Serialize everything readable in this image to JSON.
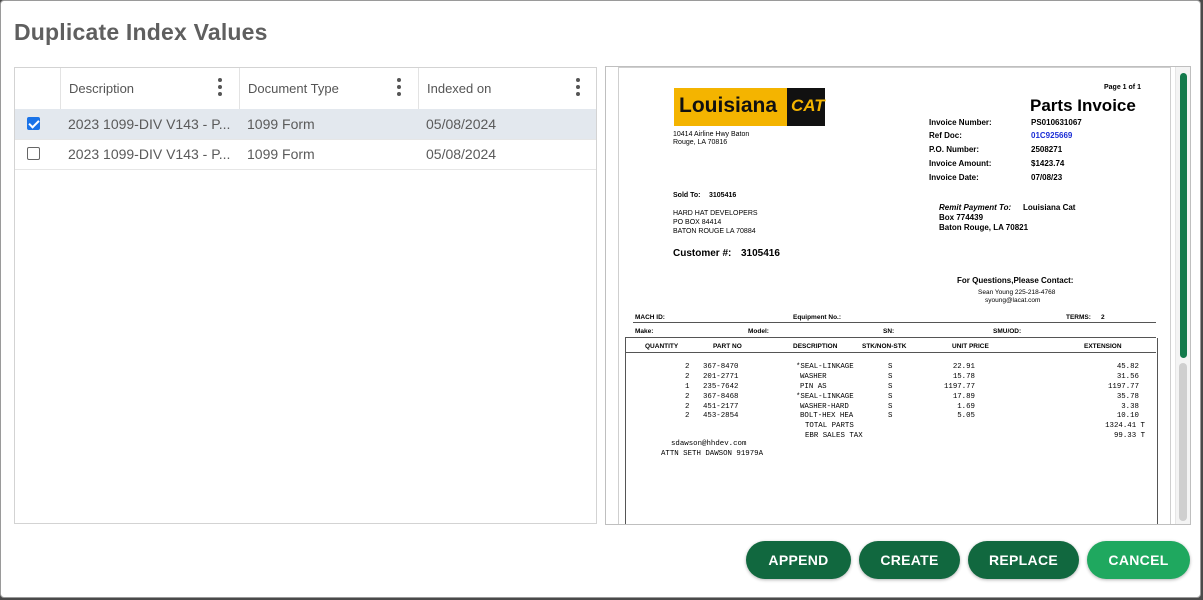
{
  "dialog": {
    "title": "Duplicate Index Values"
  },
  "grid": {
    "columns": [
      "Description",
      "Document Type",
      "Indexed on"
    ],
    "rows": [
      {
        "checked": true,
        "description": "2023 1099-DIV V143 - P...",
        "document_type": "1099 Form",
        "indexed_on": "05/08/2024"
      },
      {
        "checked": false,
        "description": "2023 1099-DIV V143 - P...",
        "document_type": "1099 Form",
        "indexed_on": "05/08/2024"
      }
    ]
  },
  "invoice": {
    "page_label": "Page 1 of 1",
    "logo_text": "Louisiana",
    "logo_cat": "CAT",
    "company_address_1": "10414 Airline Hwy Baton",
    "company_address_2": "Rouge, LA 70816",
    "doc_title": "Parts Invoice",
    "fields": [
      {
        "label": "Invoice Number:",
        "value": "PS010631067"
      },
      {
        "label": "Ref Doc:",
        "value": "01C925669"
      },
      {
        "label": "P.O. Number:",
        "value": "2508271"
      },
      {
        "label": "Invoice Amount:",
        "value": "$1423.74"
      },
      {
        "label": "Invoice Date:",
        "value": "07/08/23"
      }
    ],
    "sold_to_label": "Sold To:",
    "sold_to_number": "3105416",
    "sold_to_lines": [
      "HARD HAT DEVELOPERS",
      "PO BOX 84414",
      "BATON ROUGE LA 70884"
    ],
    "customer_label": "Customer #:",
    "customer_number": "3105416",
    "remit_label": "Remit Payment To:",
    "remit_name": "Louisiana Cat",
    "remit_lines": [
      "Box 774439",
      "Baton Rouge, LA 70821"
    ],
    "questions_label": "For Questions,Please Contact:",
    "contact_line_1": "Sean Young 225-218-4768",
    "contact_line_2": "syoung@lacat.com",
    "meta": {
      "mach_id": "MACH ID:",
      "equipment_no": "Equipment No.:",
      "terms_label": "TERMS:",
      "terms_value": "2",
      "make": "Make:",
      "model": "Model:",
      "sn": "SN:",
      "smu": "SMU/OD:"
    },
    "table_headers": [
      "QUANTITY",
      "PART NO",
      "DESCRIPTION",
      "STK/NON-STK",
      "UNIT PRICE",
      "EXTENSION"
    ],
    "items": [
      {
        "qty": "2",
        "part": "367-8470",
        "desc": "*SEAL-LINKAGE",
        "stk": "S",
        "unit": "22.91",
        "ext": "45.82"
      },
      {
        "qty": "2",
        "part": "201-2771",
        "desc": "WASHER",
        "stk": "S",
        "unit": "15.78",
        "ext": "31.56"
      },
      {
        "qty": "1",
        "part": "235-7642",
        "desc": "PIN AS",
        "stk": "S",
        "unit": "1197.77",
        "ext": "1197.77"
      },
      {
        "qty": "2",
        "part": "367-8468",
        "desc": "*SEAL-LINKAGE",
        "stk": "S",
        "unit": "17.89",
        "ext": "35.78"
      },
      {
        "qty": "2",
        "part": "451-2177",
        "desc": "WASHER-HARD",
        "stk": "S",
        "unit": "1.69",
        "ext": "3.38"
      },
      {
        "qty": "2",
        "part": "453-2854",
        "desc": "BOLT-HEX HEA",
        "stk": "S",
        "unit": "5.05",
        "ext": "10.10"
      }
    ],
    "total_parts_label": "TOTAL PARTS",
    "total_parts_value": "1324.41 T",
    "sales_tax_label": "EBR SALES TAX",
    "sales_tax_value": "99.33 T",
    "email_line": "sdawson@hhdev.com",
    "attn_line": "ATTN SETH DAWSON 91979A"
  },
  "buttons": {
    "append": "APPEND",
    "create": "CREATE",
    "replace": "REPLACE",
    "cancel": "CANCEL"
  },
  "colors": {
    "primary_button": "#11683f",
    "cancel_button": "#1fa85f",
    "scrollbar": "#137a4c",
    "checkbox": "#1a73e8",
    "logo_yellow": "#f4b400"
  }
}
